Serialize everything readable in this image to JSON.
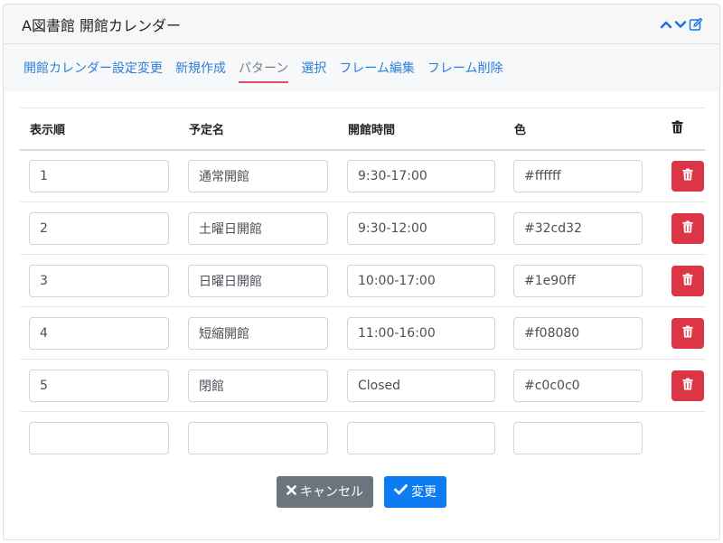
{
  "header": {
    "title": "A図書館 開館カレンダー"
  },
  "nav": [
    {
      "label": "開館カレンダー設定変更",
      "active": false
    },
    {
      "label": "新規作成",
      "active": false
    },
    {
      "label": "パターン",
      "active": true
    },
    {
      "label": "選択",
      "active": false
    },
    {
      "label": "フレーム編集",
      "active": false
    },
    {
      "label": "フレーム削除",
      "active": false
    }
  ],
  "table": {
    "columns": [
      "表示順",
      "予定名",
      "開館時間",
      "色"
    ],
    "rows": [
      {
        "order": "1",
        "name": "通常開館",
        "time": "9:30-17:00",
        "color": "#ffffff"
      },
      {
        "order": "2",
        "name": "土曜日開館",
        "time": "9:30-12:00",
        "color": "#32cd32"
      },
      {
        "order": "3",
        "name": "日曜日開館",
        "time": "10:00-17:00",
        "color": "#1e90ff"
      },
      {
        "order": "4",
        "name": "短縮開館",
        "time": "11:00-16:00",
        "color": "#f08080"
      },
      {
        "order": "5",
        "name": "閉館",
        "time": "Closed",
        "color": "#c0c0c0"
      },
      {
        "order": "",
        "name": "",
        "time": "",
        "color": ""
      }
    ]
  },
  "buttons": {
    "cancel": "キャンセル",
    "save": "変更"
  },
  "icons": {
    "collapse": "chevron-up-icon",
    "expand": "chevron-down-icon",
    "edit": "edit-icon",
    "trash": "trash-icon",
    "cancel": "x-icon",
    "save": "check-icon"
  },
  "colors": {
    "accent": "#2f7fd6",
    "danger": "#dc3545",
    "primary": "#0d7bf1",
    "secondary": "#6c757d"
  }
}
